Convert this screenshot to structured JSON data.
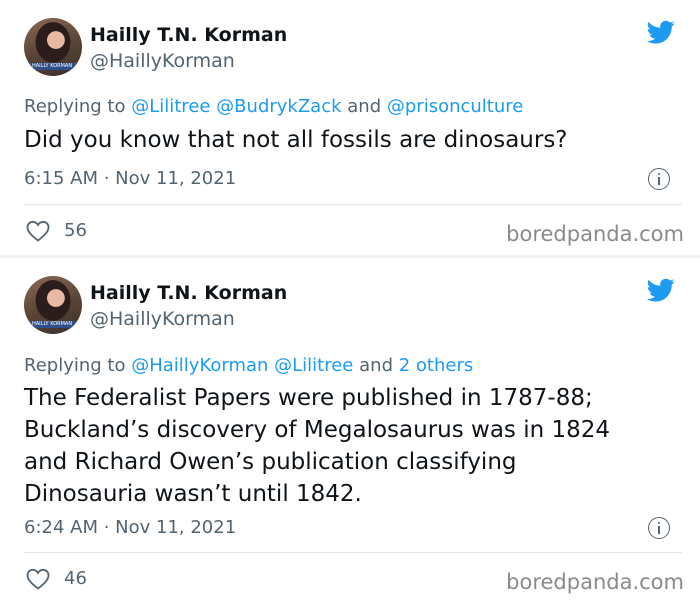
{
  "tweets": [
    {
      "author_name": "Hailly T.N. Korman",
      "author_handle": "@HaillyKorman",
      "avatar_caption": "HAILLY KORMAN",
      "replying_prefix": "Replying to",
      "replying_to": "@Lilitree @BudrykZack",
      "replying_conj": "and",
      "replying_last": "@prisonculture",
      "text": "Did you know that not all fossils are dinosaurs?",
      "timestamp": "6:15 AM · Nov 11, 2021",
      "likes": "56",
      "watermark": "boredpanda.com"
    },
    {
      "author_name": "Hailly T.N. Korman",
      "author_handle": "@HaillyKorman",
      "avatar_caption": "HAILLY KORMAN",
      "replying_prefix": "Replying to",
      "replying_to": "@HaillyKorman @Lilitree",
      "replying_conj": "and",
      "replying_last": "2 others",
      "text_lines": [
        "The Federalist Papers were published in 1787-88;",
        "Buckland’s discovery of Megalosaurus was in 1824",
        "and Richard Owen’s publication classifying",
        "Dinosauria wasn’t until 1842."
      ],
      "timestamp": "6:24 AM · Nov 11, 2021",
      "likes": "46",
      "watermark": "boredpanda.com"
    }
  ],
  "icons": {
    "brand": "twitter-bird-icon",
    "info": "info-icon",
    "like": "heart-icon"
  },
  "colors": {
    "twitter_blue": "#1d9bf0",
    "secondary_text": "#536471",
    "primary_text": "#0f1419"
  }
}
